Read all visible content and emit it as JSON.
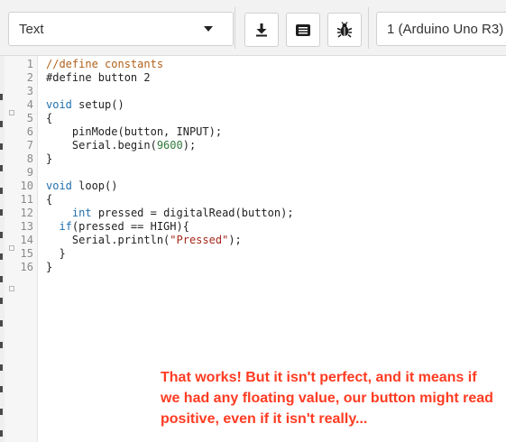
{
  "toolbar": {
    "mode_select": {
      "value": "Text"
    },
    "buttons": [
      {
        "name": "download",
        "icon": "download-icon"
      },
      {
        "name": "upload",
        "icon": "upload-icon"
      },
      {
        "name": "debug",
        "icon": "bug-icon"
      }
    ],
    "board_select": {
      "value": "1 (Arduino Uno R3)"
    }
  },
  "editor": {
    "line_numbers": [
      "1",
      "2",
      "3",
      "4",
      "5",
      "6",
      "7",
      "8",
      "9",
      "10",
      "11",
      "12",
      "13",
      "14",
      "15",
      "16"
    ],
    "lines": [
      [
        {
          "t": "//define constants",
          "c": "cm"
        }
      ],
      [
        {
          "t": "#define button 2",
          "c": ""
        }
      ],
      [
        {
          "t": "",
          "c": ""
        }
      ],
      [
        {
          "t": "void",
          "c": "kw"
        },
        {
          "t": " setup()",
          "c": ""
        }
      ],
      [
        {
          "t": "{",
          "c": ""
        }
      ],
      [
        {
          "t": "    pinMode(button, INPUT);",
          "c": ""
        }
      ],
      [
        {
          "t": "    Serial.begin(",
          "c": ""
        },
        {
          "t": "9600",
          "c": "num"
        },
        {
          "t": ");",
          "c": ""
        }
      ],
      [
        {
          "t": "}",
          "c": ""
        }
      ],
      [
        {
          "t": "",
          "c": ""
        }
      ],
      [
        {
          "t": "void",
          "c": "kw"
        },
        {
          "t": " loop()",
          "c": ""
        }
      ],
      [
        {
          "t": "{",
          "c": ""
        }
      ],
      [
        {
          "t": "    ",
          "c": ""
        },
        {
          "t": "int",
          "c": "kw"
        },
        {
          "t": " pressed = digitalRead(button);",
          "c": ""
        }
      ],
      [
        {
          "t": "  ",
          "c": ""
        },
        {
          "t": "if",
          "c": "kw"
        },
        {
          "t": "(pressed == HIGH){",
          "c": ""
        }
      ],
      [
        {
          "t": "    Serial.println(",
          "c": ""
        },
        {
          "t": "\"Pressed\"",
          "c": "str"
        },
        {
          "t": ");",
          "c": ""
        }
      ],
      [
        {
          "t": "  }",
          "c": ""
        }
      ],
      [
        {
          "t": "}",
          "c": ""
        }
      ]
    ]
  },
  "annotation": {
    "text": "That works! But it isn't perfect, and it means if we had any floating value, our button might read positive, even if it isn't really...",
    "color": "#ff3b22"
  },
  "colors": {
    "keyword": "#1f6fae",
    "comment": "#b0601a",
    "number": "#2f7a3a",
    "string": "#a4281b"
  }
}
